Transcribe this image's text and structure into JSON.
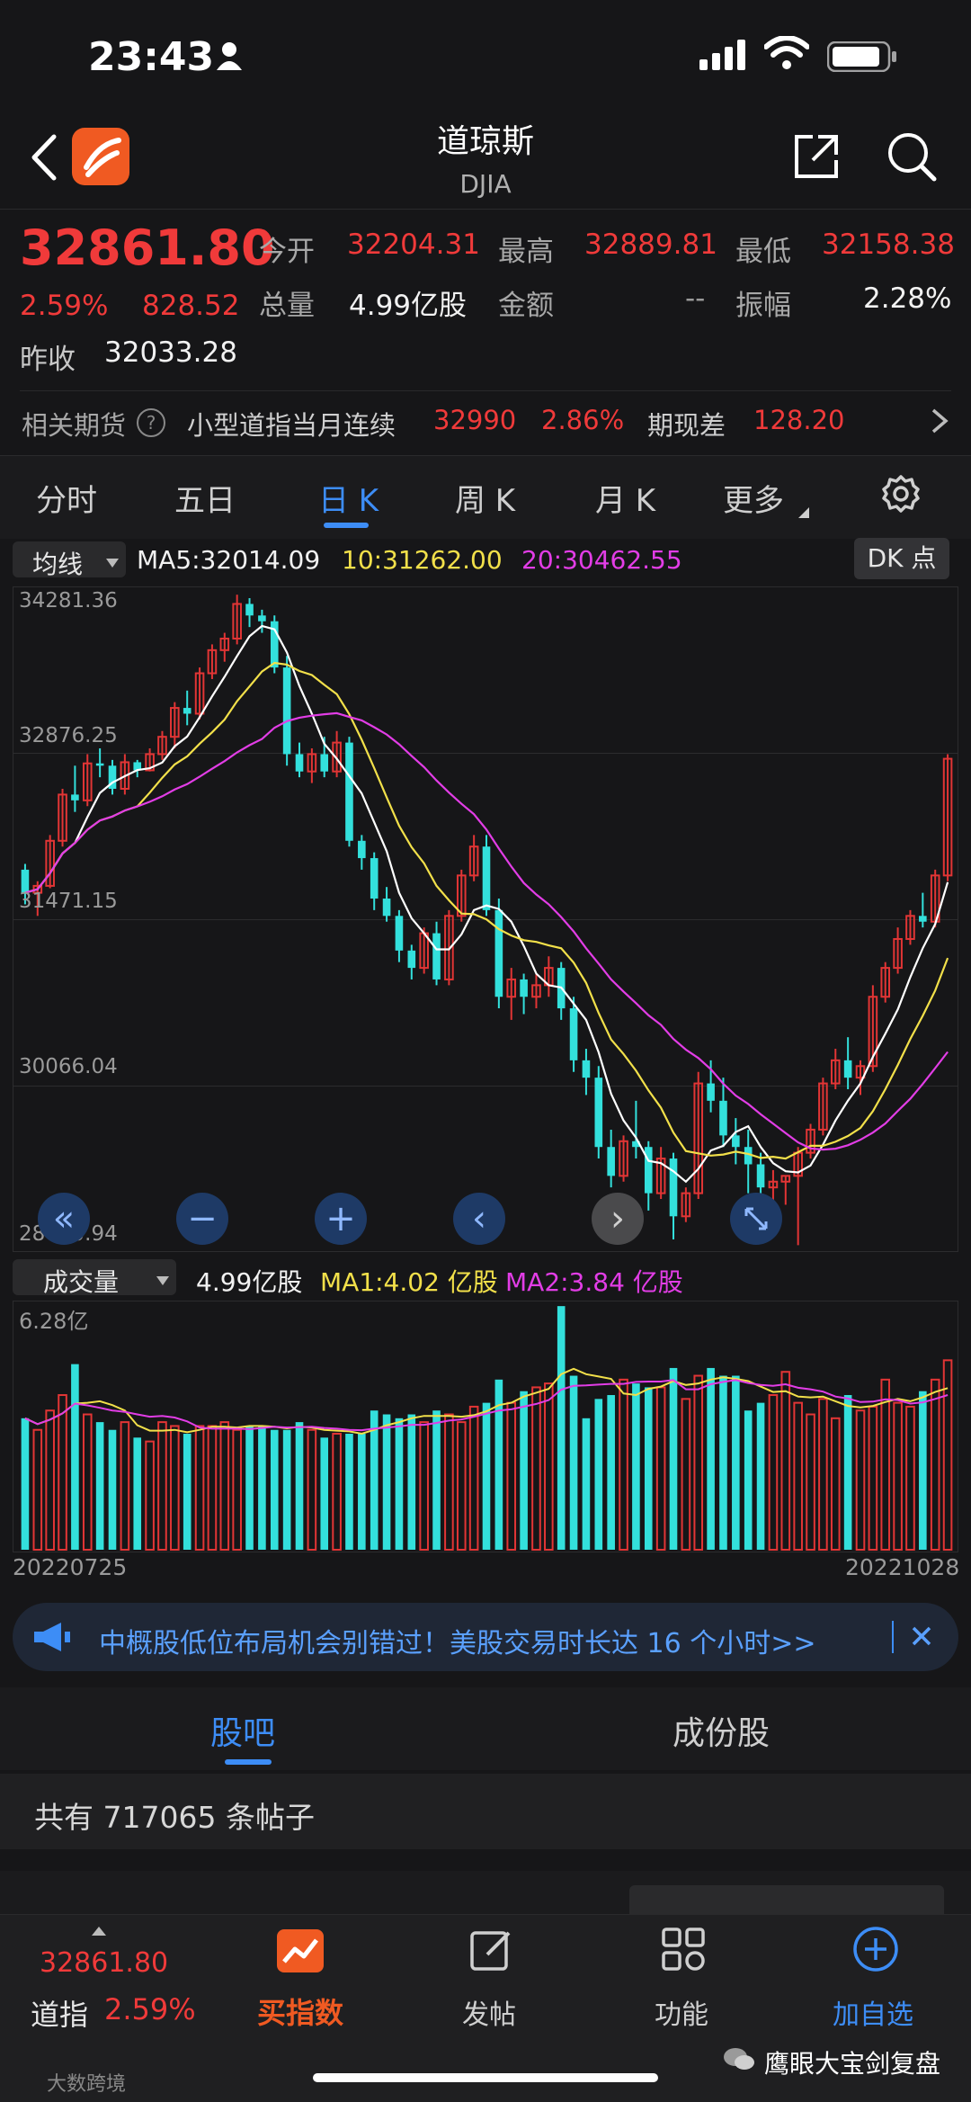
{
  "status": {
    "time": "23:43"
  },
  "header": {
    "title": "道琼斯",
    "subtitle": "DJIA"
  },
  "quote": {
    "price": "32861.80",
    "change_pct": "2.59%",
    "change": "828.52",
    "prev_close_label": "昨收",
    "prev_close": "32033.28",
    "open_label": "今开",
    "open": "32204.31",
    "high_label": "最高",
    "high": "32889.81",
    "low_label": "最低",
    "low": "32158.38",
    "volume_label": "总量",
    "volume": "4.99亿股",
    "amount_label": "金额",
    "amount": "--",
    "amplitude_label": "振幅",
    "amplitude": "2.28%"
  },
  "futures": {
    "label": "相关期货",
    "name": "小型道指当月连续",
    "price": "32990",
    "pct": "2.86%",
    "basis_label": "期现差",
    "basis": "128.20"
  },
  "tabs": [
    "分时",
    "五日",
    "日 K",
    "周 K",
    "月 K",
    "更多"
  ],
  "ma_bar": {
    "selector": "均线",
    "ma5": "MA5:32014.09",
    "ma10": "10:31262.00",
    "ma20": "20:30462.55",
    "dk_button": "DK 点"
  },
  "kline": {
    "y_labels": [
      "34281.36",
      "32876.25",
      "31471.15",
      "30066.04",
      "28660.94"
    ],
    "ymin": 28660.94,
    "ymax": 34281.36
  },
  "vol_bar": {
    "selector": "成交量",
    "value": "4.99亿股",
    "ma1": "MA1:4.02 亿股",
    "ma2": "MA2:3.84 亿股",
    "max_label": "6.28亿",
    "date_start": "20220725",
    "date_end": "20221028"
  },
  "chart_data": {
    "type": "candlestick",
    "x_range": [
      "20220725",
      "20221028"
    ],
    "y_range": [
      28660.94,
      34281.36
    ],
    "volume_max": 6.28,
    "colors": {
      "up": "#e23535",
      "down": "#33e0dc",
      "ma5": "#ffffff",
      "ma10": "#f2e04a",
      "ma20": "#e23de6"
    },
    "ohlc": [
      [
        31900,
        31950,
        31600,
        31700
      ],
      [
        31700,
        31800,
        31500,
        31760
      ],
      [
        31760,
        32200,
        31740,
        32150
      ],
      [
        32150,
        32600,
        32100,
        32550
      ],
      [
        32550,
        32800,
        32400,
        32500
      ],
      [
        32500,
        32900,
        32450,
        32820
      ],
      [
        32820,
        32950,
        32700,
        32800
      ],
      [
        32800,
        32850,
        32550,
        32600
      ],
      [
        32600,
        32900,
        32550,
        32830
      ],
      [
        32830,
        32850,
        32700,
        32760
      ],
      [
        32760,
        32950,
        32750,
        32900
      ],
      [
        32900,
        33100,
        32850,
        33050
      ],
      [
        33050,
        33350,
        32950,
        33300
      ],
      [
        33300,
        33450,
        33150,
        33250
      ],
      [
        33250,
        33650,
        33200,
        33600
      ],
      [
        33600,
        33850,
        33550,
        33800
      ],
      [
        33800,
        33950,
        33700,
        33900
      ],
      [
        33900,
        34280,
        33850,
        34200
      ],
      [
        34200,
        34250,
        34000,
        34100
      ],
      [
        34100,
        34150,
        33950,
        34050
      ],
      [
        34050,
        34100,
        33600,
        33650
      ],
      [
        33650,
        33750,
        32800,
        32900
      ],
      [
        32900,
        33000,
        32700,
        32750
      ],
      [
        32750,
        32950,
        32650,
        32900
      ],
      [
        32900,
        33050,
        32700,
        32750
      ],
      [
        32750,
        33100,
        32700,
        33000
      ],
      [
        33000,
        33050,
        32100,
        32150
      ],
      [
        32150,
        32200,
        31900,
        32000
      ],
      [
        32000,
        32050,
        31550,
        31650
      ],
      [
        31650,
        31750,
        31450,
        31500
      ],
      [
        31500,
        31550,
        31100,
        31200
      ],
      [
        31200,
        31250,
        30950,
        31050
      ],
      [
        31050,
        31400,
        31000,
        31350
      ],
      [
        31350,
        31450,
        30900,
        30950
      ],
      [
        30950,
        31550,
        30900,
        31500
      ],
      [
        31500,
        31900,
        31450,
        31850
      ],
      [
        31850,
        32200,
        31800,
        32100
      ],
      [
        32100,
        32200,
        31500,
        31550
      ],
      [
        31550,
        31650,
        30700,
        30800
      ],
      [
        30800,
        31050,
        30600,
        30950
      ],
      [
        30950,
        31000,
        30650,
        30800
      ],
      [
        30800,
        31000,
        30700,
        30900
      ],
      [
        30900,
        31150,
        30800,
        31050
      ],
      [
        31050,
        31100,
        30600,
        30700
      ],
      [
        30700,
        30800,
        30150,
        30250
      ],
      [
        30250,
        30350,
        29950,
        30100
      ],
      [
        30100,
        30200,
        29400,
        29500
      ],
      [
        29500,
        29650,
        29150,
        29250
      ],
      [
        29250,
        29600,
        29200,
        29550
      ],
      [
        29550,
        29900,
        29400,
        29500
      ],
      [
        29500,
        29550,
        28950,
        29100
      ],
      [
        29100,
        29500,
        29050,
        29400
      ],
      [
        29400,
        29450,
        28700,
        28900
      ],
      [
        28900,
        29150,
        28850,
        29100
      ],
      [
        29100,
        30150,
        29050,
        30050
      ],
      [
        30050,
        30250,
        29800,
        29900
      ],
      [
        29900,
        30100,
        29500,
        29600
      ],
      [
        29600,
        29750,
        29350,
        29500
      ],
      [
        29500,
        29650,
        29100,
        29350
      ],
      [
        29350,
        29450,
        28950,
        29150
      ],
      [
        29150,
        29300,
        28900,
        29200
      ],
      [
        29200,
        29250,
        29000,
        29250
      ],
      [
        29250,
        29500,
        28650,
        29450
      ],
      [
        29450,
        29700,
        29400,
        29650
      ],
      [
        29650,
        30100,
        29600,
        30050
      ],
      [
        30050,
        30350,
        30000,
        30250
      ],
      [
        30250,
        30450,
        30000,
        30100
      ],
      [
        30100,
        30250,
        29950,
        30200
      ],
      [
        30200,
        30900,
        30150,
        30800
      ],
      [
        30800,
        31100,
        30750,
        31050
      ],
      [
        31050,
        31400,
        31000,
        31300
      ],
      [
        31300,
        31550,
        31250,
        31500
      ],
      [
        31500,
        31700,
        31400,
        31450
      ],
      [
        31450,
        31900,
        31400,
        31850
      ],
      [
        31850,
        32900,
        31800,
        32860
      ]
    ],
    "volume": [
      3.4,
      3.1,
      3.6,
      4.0,
      4.8,
      3.5,
      3.3,
      3.1,
      3.3,
      2.9,
      2.8,
      3.3,
      3.2,
      3.0,
      3.2,
      3.2,
      3.3,
      3.1,
      3.2,
      3.2,
      3.1,
      3.1,
      3.3,
      3.1,
      2.9,
      3.0,
      3.0,
      3.0,
      3.6,
      3.5,
      3.4,
      3.5,
      3.3,
      3.6,
      3.5,
      3.3,
      3.7,
      3.8,
      4.4,
      3.8,
      4.1,
      4.2,
      4.3,
      6.3,
      4.5,
      3.4,
      3.9,
      4.0,
      4.4,
      4.3,
      4.2,
      4.2,
      4.7,
      3.9,
      4.5,
      4.7,
      4.5,
      4.5,
      3.6,
      3.8,
      4.0,
      4.6,
      3.8,
      3.5,
      3.9,
      3.4,
      4.0,
      3.6,
      3.7,
      4.4,
      3.8,
      3.7,
      4.1,
      4.4,
      4.9
    ]
  },
  "banner": {
    "text": "中概股低位布局机会别错过！美股交易时长达 16 个小时>>"
  },
  "community_tabs": [
    "股吧",
    "成份股"
  ],
  "posts_count": "共有 717065 条帖子",
  "bottom_bar": {
    "price": "32861.80",
    "name": "道指",
    "pct": "2.59%",
    "buy_index": "买指数",
    "post": "发帖",
    "functions": "功能",
    "add_watch": "加自选"
  },
  "watermarks": {
    "left": "大数跨境",
    "right": "鹰眼大宝剑复盘"
  }
}
